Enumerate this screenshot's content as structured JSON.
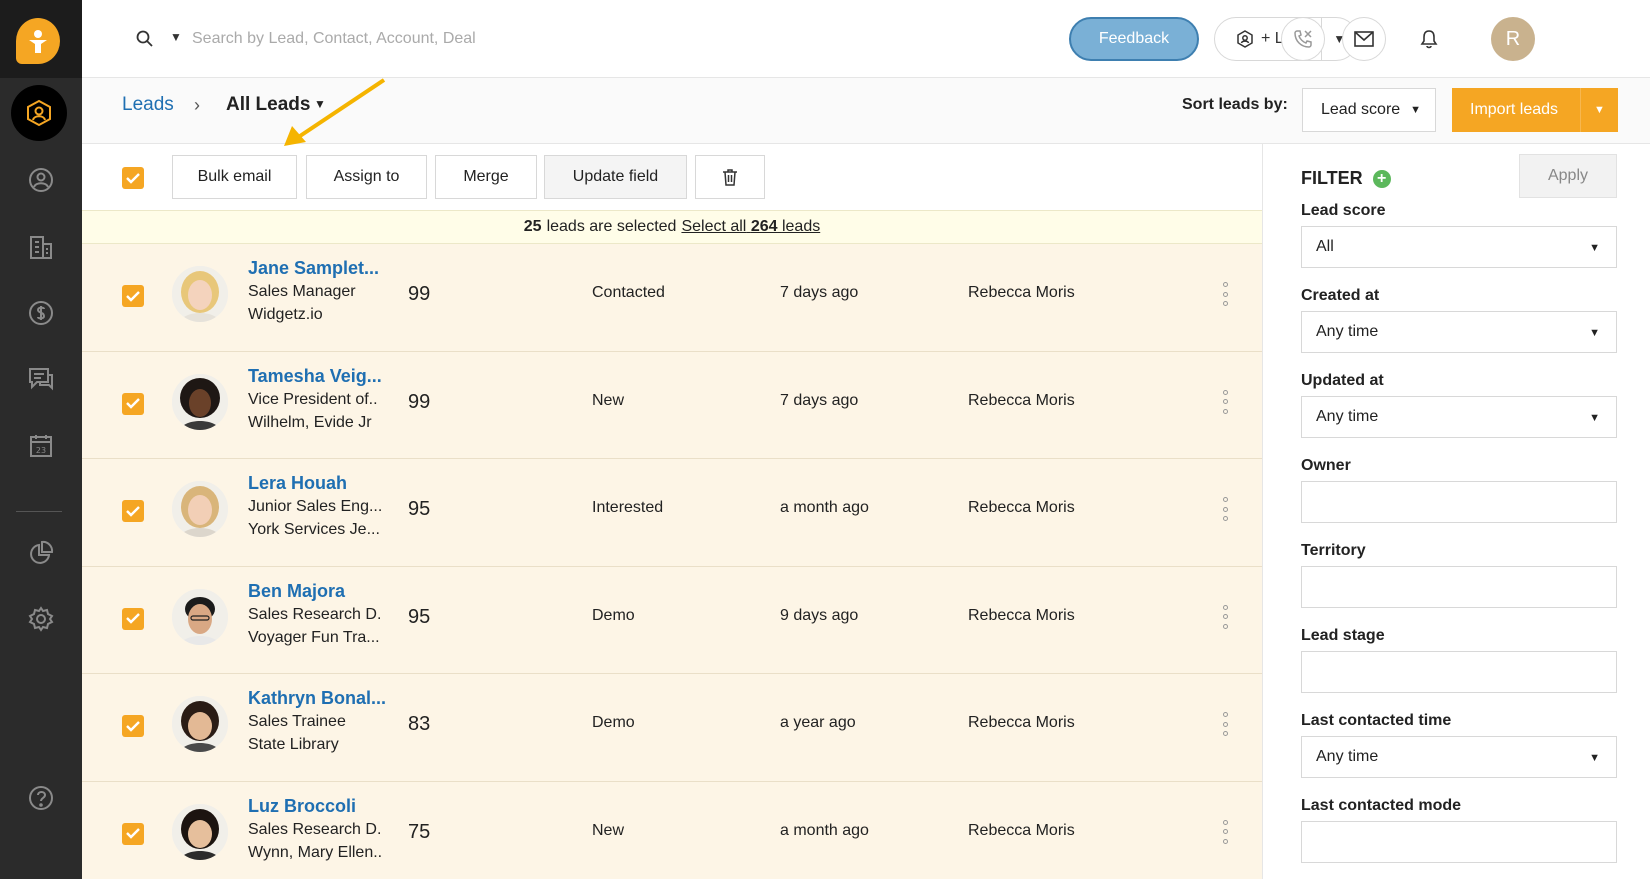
{
  "topbar": {
    "search_placeholder": "Search by Lead, Contact, Account, Deal",
    "feedback_label": "Feedback",
    "lead_button_label": "+ Lead",
    "avatar_initial": "R"
  },
  "header": {
    "breadcrumb_root": "Leads",
    "breadcrumb_current": "All Leads",
    "sort_label": "Sort leads by:",
    "sort_value": "Lead score",
    "import_label": "Import leads"
  },
  "actions": {
    "bulk_email": "Bulk email",
    "assign_to": "Assign to",
    "merge": "Merge",
    "update_field": "Update field"
  },
  "selection": {
    "count": "25",
    "text": "leads are selected",
    "select_all_prefix": "Select all",
    "total": "264",
    "select_all_suffix": "leads"
  },
  "leads": [
    {
      "name": "Jane Samplet...",
      "title": "Sales Manager",
      "company": "Widgetz.io",
      "score": "99",
      "stage": "Contacted",
      "time": "7 days ago",
      "owner": "Rebecca Moris"
    },
    {
      "name": "Tamesha Veig...",
      "title": "Vice President of..",
      "company": "Wilhelm, Evide Jr",
      "score": "99",
      "stage": "New",
      "time": "7 days ago",
      "owner": "Rebecca Moris"
    },
    {
      "name": "Lera Houah",
      "title": "Junior Sales Eng...",
      "company": "York Services Je...",
      "score": "95",
      "stage": "Interested",
      "time": "a month ago",
      "owner": "Rebecca Moris"
    },
    {
      "name": "Ben Majora",
      "title": "Sales Research D.",
      "company": "Voyager Fun Tra...",
      "score": "95",
      "stage": "Demo",
      "time": "9 days ago",
      "owner": "Rebecca Moris"
    },
    {
      "name": "Kathryn Bonal...",
      "title": "Sales Trainee",
      "company": "State Library",
      "score": "83",
      "stage": "Demo",
      "time": "a year ago",
      "owner": "Rebecca Moris"
    },
    {
      "name": "Luz Broccoli",
      "title": "Sales Research D.",
      "company": "Wynn, Mary Ellen..",
      "score": "75",
      "stage": "New",
      "time": "a month ago",
      "owner": "Rebecca Moris"
    }
  ],
  "filter": {
    "title": "FILTER",
    "apply_label": "Apply",
    "lead_score_label": "Lead score",
    "lead_score_value": "All",
    "created_at_label": "Created at",
    "created_at_value": "Any time",
    "updated_at_label": "Updated at",
    "updated_at_value": "Any time",
    "owner_label": "Owner",
    "territory_label": "Territory",
    "lead_stage_label": "Lead stage",
    "last_contacted_time_label": "Last contacted time",
    "last_contacted_time_value": "Any time",
    "last_contacted_mode_label": "Last contacted mode"
  },
  "colors": {
    "accent": "#f5a623",
    "link": "#1f6fb2",
    "row_bg": "#fdf5e6",
    "sidebar": "#2b2b2b"
  }
}
